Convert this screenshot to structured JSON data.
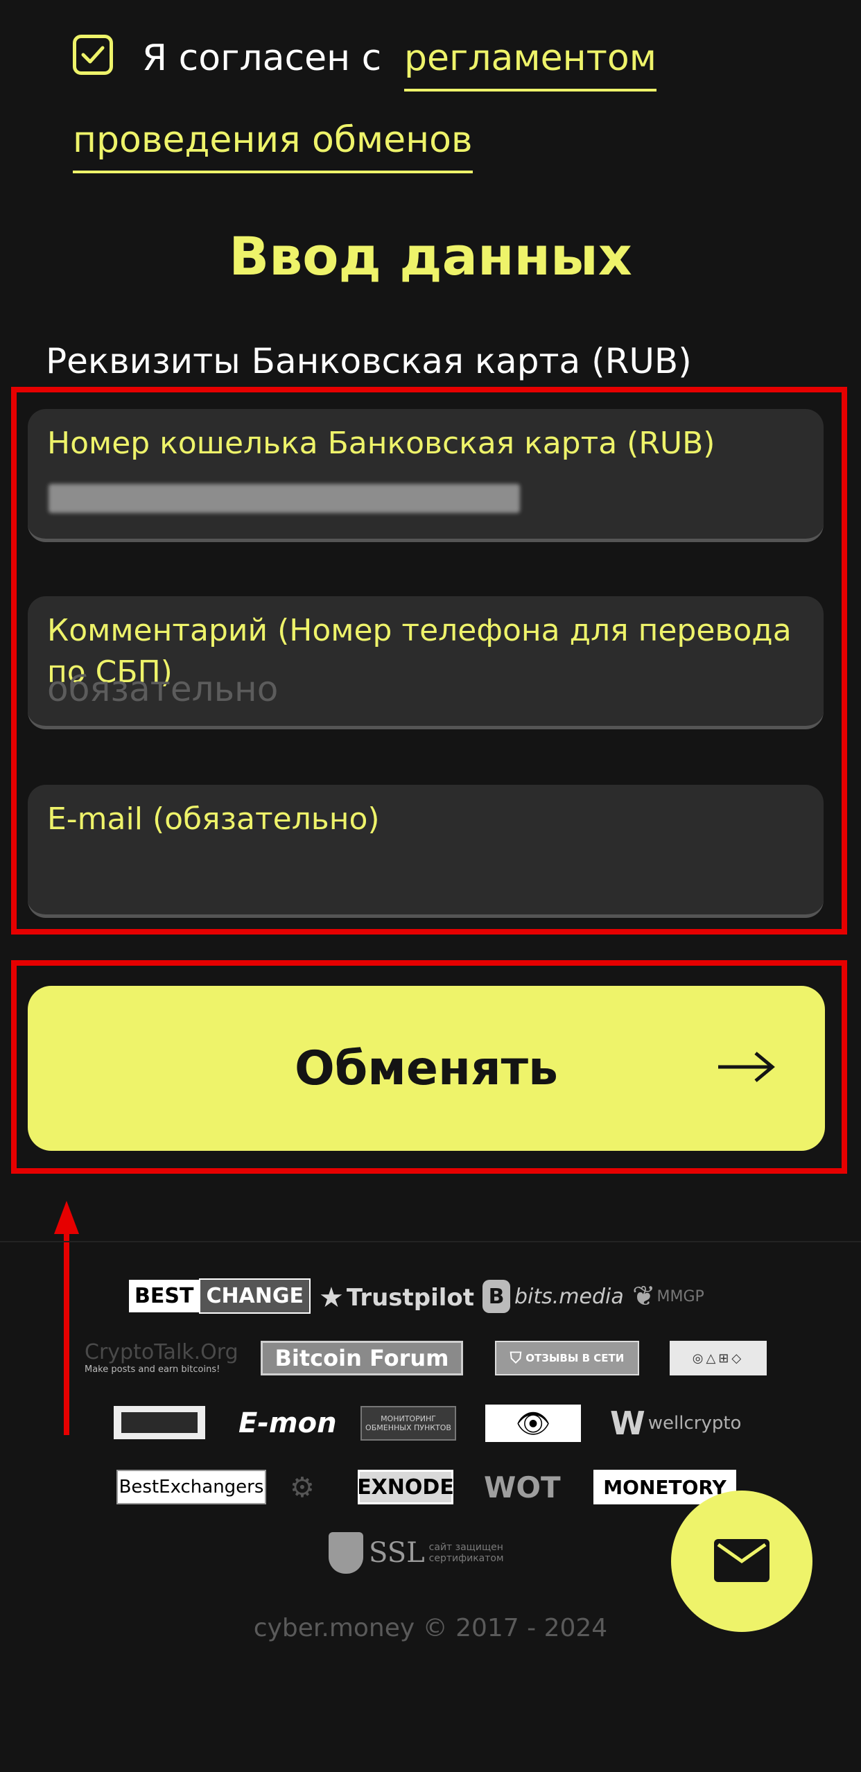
{
  "agreement": {
    "checked": true,
    "text": "Я согласен с",
    "link_part1": "регламентом",
    "link_part2": "проведения обменов"
  },
  "form": {
    "title": "Ввод данных",
    "subtitle": "Реквизиты Банковская карта (RUB)",
    "fields": [
      {
        "label": "Номер кошелька Банковская карта (RUB)",
        "value": "(скрыто)"
      },
      {
        "label": "Комментарий (Номер телефона для перевода по СБП)",
        "placeholder": "обязательно"
      },
      {
        "label": "E-mail (обязательно)",
        "value": ""
      }
    ],
    "submit_label": "Обменять"
  },
  "partners": [
    "BEST",
    "CHANGE",
    "Trustpilot",
    "bits.media",
    "MMGP",
    "CryptoTalk.Org",
    "Make posts and earn bitcoins!",
    "Bitcoin Forum",
    "ОТЗЫВЫ В СЕТИ",
    "E-mon",
    "МОНИТОРИНГ ОБМЕННЫХ ПУНКТОВ",
    "wellcrypto",
    "BestExchangers",
    "EXNODE",
    "WOT",
    "MONETORY",
    "SSL",
    "сайт защищен сертификатом"
  ],
  "footer": {
    "copyright": "cyber.money © 2017 - 2024"
  },
  "colors": {
    "accent": "#eef36a",
    "background": "#141414",
    "field_bg": "#2c2c2c",
    "highlight": "#e60000"
  }
}
